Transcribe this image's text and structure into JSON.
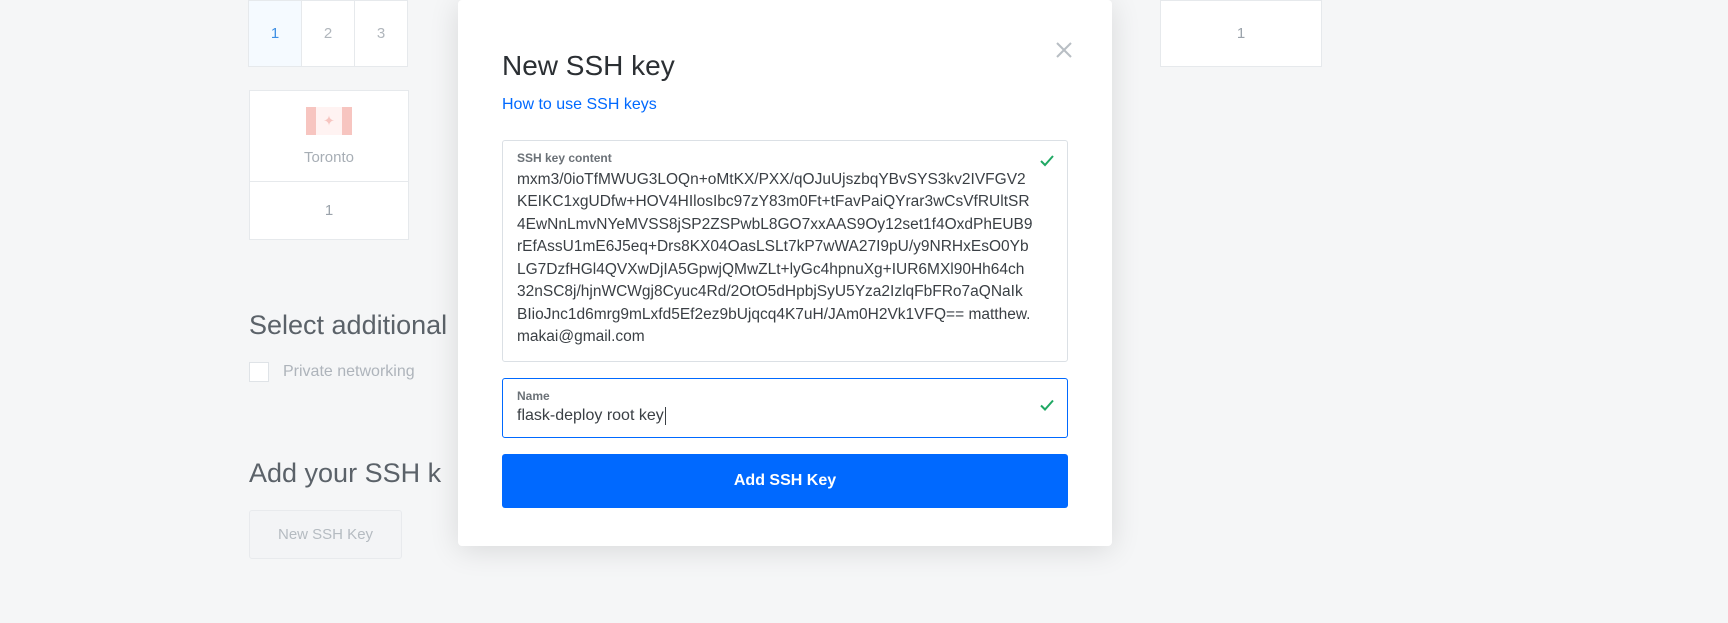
{
  "background": {
    "pagination": [
      "1",
      "2",
      "3"
    ],
    "pagination_active_index": 0,
    "right_box_value": "1",
    "region": {
      "name": "Toronto",
      "count": "1"
    },
    "section_additional": "Select additional",
    "checkbox_label": "Private networking",
    "section_ssh": "Add your SSH k",
    "new_ssh_button": "New SSH Key"
  },
  "modal": {
    "title": "New SSH key",
    "help_link": "How to use SSH keys",
    "key_content_label": "SSH key content",
    "key_content_value": "mxm3/0ioTfMWUG3LOQn+oMtKX/PXX/qOJuUjszbqYBvSYS3kv2IVFGV2KEIKC1xgUDfw+HOV4HIlosIbc97zY83m0Ft+tFavPaiQYrar3wCsVfRUltSR4EwNnLmvNYeMVSS8jSP2ZSPwbL8GO7xxAAS9Oy12set1f4OxdPhEUB9rEfAssU1mE6J5eq+Drs8KX04OasLSLt7kP7wWA27I9pU/y9NRHxEsO0YbLG7DzfHGl4QVXwDjIA5GpwjQMwZLt+lyGc4hpnuXg+IUR6MXl90Hh64ch32nSC8j/hjnWCWgj8Cyuc4Rd/2OtO5dHpbjSyU5Yza2IzlqFbFRo7aQNaIkBIioJnc1d6mrg9mLxfd5Ef2ez9bUjqcq4K7uH/JAm0H2Vk1VFQ== matthew.makai@gmail.com",
    "name_label": "Name",
    "name_value": "flask-deploy root key",
    "submit_label": "Add SSH Key"
  }
}
